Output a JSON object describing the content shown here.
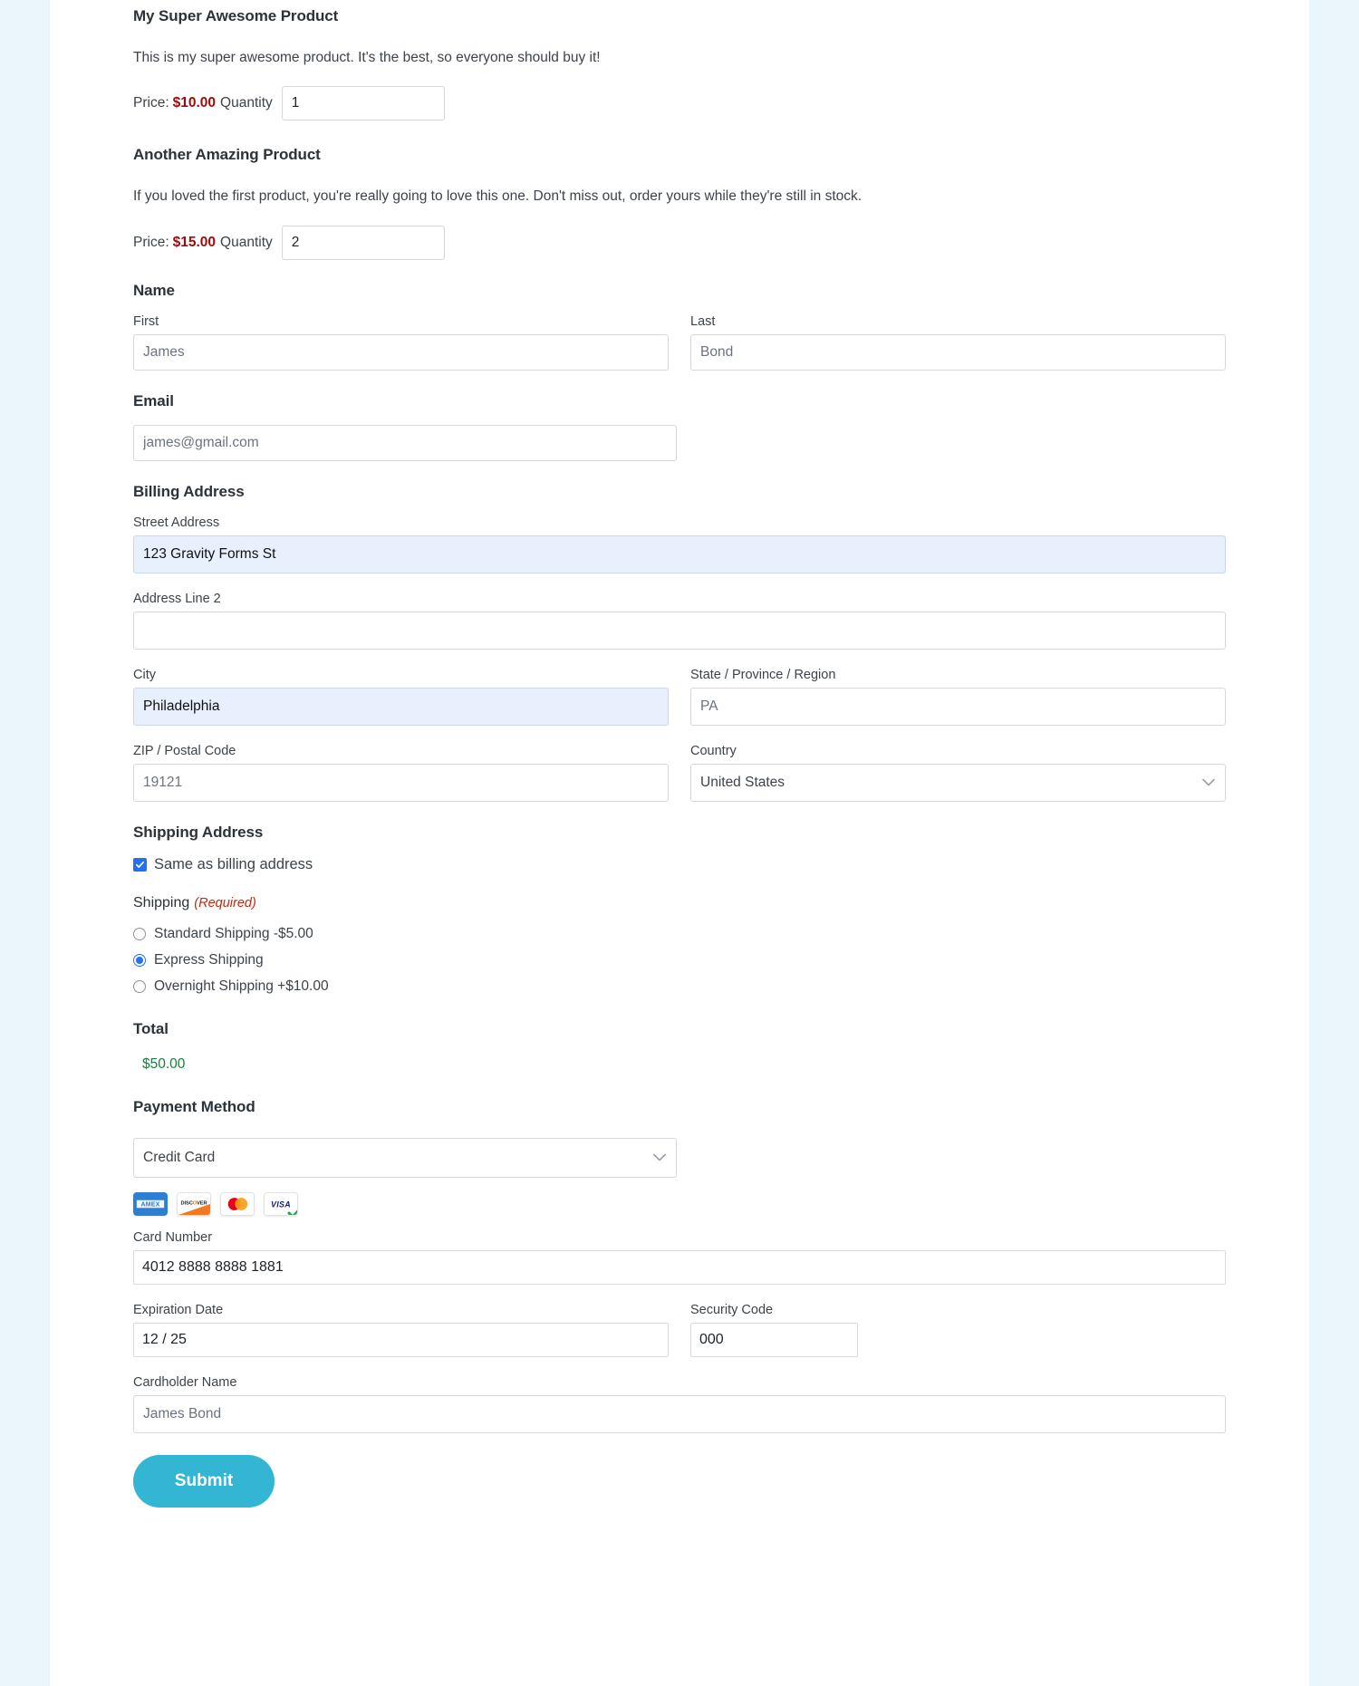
{
  "theme": {
    "page_background": "#eaf6fb",
    "content_background": "#ffffff",
    "price_color": "#a00b0b",
    "total_color": "#17803d",
    "required_color": "#c02b0a",
    "autofill_background": "#e8f0fe",
    "accent_button": "#33b5d4",
    "radio_accent": "#2271f1"
  },
  "products": [
    {
      "title": "My Super Awesome Product",
      "description": "This is my super awesome product. It's the best, so everyone should buy it!",
      "price_label": "Price:",
      "price": "$10.00",
      "quantity_label": "Quantity",
      "quantity_value": "1"
    },
    {
      "title": "Another Amazing Product",
      "description": "If you loved the first product, you're really going to love this one. Don't miss out, order yours while they're still in stock.",
      "price_label": "Price:",
      "price": "$15.00",
      "quantity_label": "Quantity",
      "quantity_value": "2"
    }
  ],
  "name_section": {
    "title": "Name",
    "first_label": "First",
    "first_value": "James",
    "last_label": "Last",
    "last_value": "Bond"
  },
  "email_section": {
    "title": "Email",
    "value": "james@gmail.com"
  },
  "billing_address": {
    "title": "Billing Address",
    "street_label": "Street Address",
    "street_value": "123 Gravity Forms St",
    "line2_label": "Address Line 2",
    "line2_value": "",
    "city_label": "City",
    "city_value": "Philadelphia",
    "state_label": "State / Province / Region",
    "state_value": "PA",
    "zip_label": "ZIP / Postal Code",
    "zip_value": "19121",
    "country_label": "Country",
    "country_value": "United States"
  },
  "shipping_address": {
    "title": "Shipping Address",
    "same_as_billing_label": "Same as billing address",
    "same_as_billing_checked": true
  },
  "shipping": {
    "title": "Shipping",
    "required_tag": "(Required)",
    "options": [
      {
        "label": "Standard Shipping -$5.00",
        "selected": false
      },
      {
        "label": "Express Shipping",
        "selected": true
      },
      {
        "label": "Overnight Shipping +$10.00",
        "selected": false
      }
    ]
  },
  "total": {
    "title": "Total",
    "amount": "$50.00"
  },
  "payment": {
    "title": "Payment Method",
    "method_value": "Credit Card",
    "card_brands": [
      "amex-card-icon",
      "discover-card-icon",
      "mastercard-card-icon",
      "visa-card-icon"
    ],
    "card_number_label": "Card Number",
    "card_number_value": "4012 8888 8888 1881",
    "expiration_label": "Expiration Date",
    "expiration_value": "12 / 25",
    "security_label": "Security Code",
    "security_value": "000",
    "cardholder_label": "Cardholder Name",
    "cardholder_value": "James Bond"
  },
  "submit": {
    "label": "Submit"
  }
}
